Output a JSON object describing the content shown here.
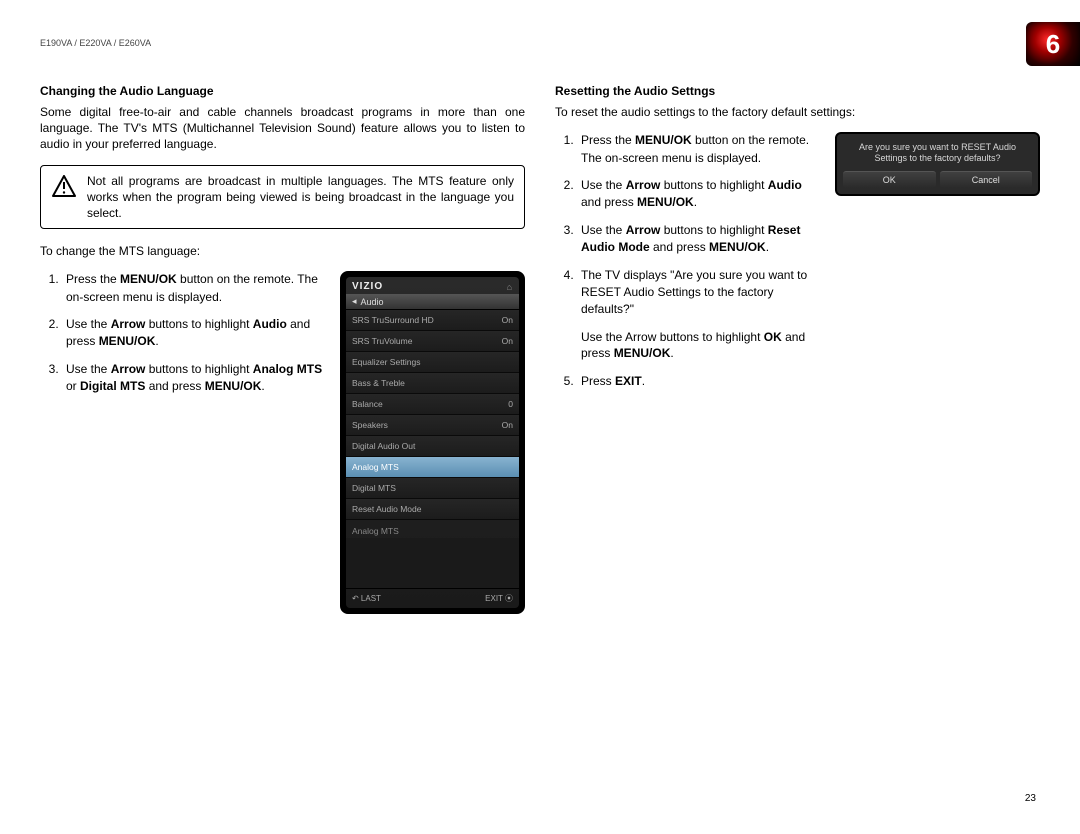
{
  "header": {
    "model": "E190VA / E220VA / E260VA",
    "chapter": "6"
  },
  "page_number": "23",
  "col1": {
    "heading": "Changing the Audio Language",
    "intro": "Some digital free-to-air and cable channels broadcast programs in more than one language. The TV's MTS (Multichannel Television Sound) feature allows you to listen to audio in your preferred language.",
    "note": "Not all programs are broadcast in multiple languages. The MTS feature only works when the program being viewed is being broadcast in the language you select.",
    "lead": "To change the MTS language:",
    "steps": [
      {
        "pre": "Press the ",
        "b1": "MENU/OK",
        "post": " button on the remote. The on-screen menu is displayed."
      },
      {
        "pre": "Use the ",
        "b1": "Arrow",
        "mid": " buttons to highlight ",
        "b2": "Audio",
        "post2": " and press ",
        "b3": "MENU/OK",
        "end": "."
      },
      {
        "pre": "Use the ",
        "b1": "Arrow",
        "mid": " buttons to highlight ",
        "b2": "Analog MTS",
        "mid2": " or ",
        "b3": "Digital MTS",
        "post2": " and press ",
        "b4": "MENU/OK",
        "end": "."
      }
    ]
  },
  "osd": {
    "brand": "VIZIO",
    "tab": "Audio",
    "rows": [
      {
        "label": "SRS TruSurround HD",
        "value": "On"
      },
      {
        "label": "SRS TruVolume",
        "value": "On"
      },
      {
        "label": "Equalizer Settings",
        "value": ""
      },
      {
        "label": "Bass & Treble",
        "value": ""
      },
      {
        "label": "Balance",
        "value": "0"
      },
      {
        "label": "Speakers",
        "value": "On"
      },
      {
        "label": "Digital Audio Out",
        "value": ""
      },
      {
        "label": "Analog MTS",
        "value": "",
        "selected": true
      },
      {
        "label": "Digital MTS",
        "value": ""
      },
      {
        "label": "Reset Audio Mode",
        "value": ""
      }
    ],
    "section_label": "Analog MTS",
    "footer_left": "↶ LAST",
    "footer_right": "EXIT ⦿"
  },
  "col2": {
    "heading": "Resetting the Audio Settngs",
    "intro": "To reset the audio settings to the factory default settings:",
    "steps": [
      {
        "pre": "Press the ",
        "b1": "MENU/OK",
        "post": " button on the remote. The on-screen menu is displayed."
      },
      {
        "pre": "Use the ",
        "b1": "Arrow",
        "mid": " buttons to highlight ",
        "b2": "Audio",
        "post2": " and press ",
        "b3": "MENU/OK",
        "end": "."
      },
      {
        "pre": "Use the ",
        "b1": "Arrow",
        "mid": " buttons to highlight ",
        "b2": "Reset Audio Mode",
        "post2": " and press ",
        "b3": "MENU/OK",
        "end": "."
      },
      {
        "pre": "The TV displays \"Are you sure you want to RESET Audio Settings to the factory defaults?\"",
        "para2_pre": "Use the Arrow buttons to highlight ",
        "para2_b": "OK",
        "para2_mid": " and press ",
        "para2_b2": "MENU/OK",
        "para2_end": "."
      },
      {
        "pre": "Press ",
        "b1": "EXIT",
        "end": "."
      }
    ]
  },
  "dialog": {
    "text": "Are you sure you want to RESET Audio Settings to the factory defaults?",
    "ok": "OK",
    "cancel": "Cancel"
  }
}
